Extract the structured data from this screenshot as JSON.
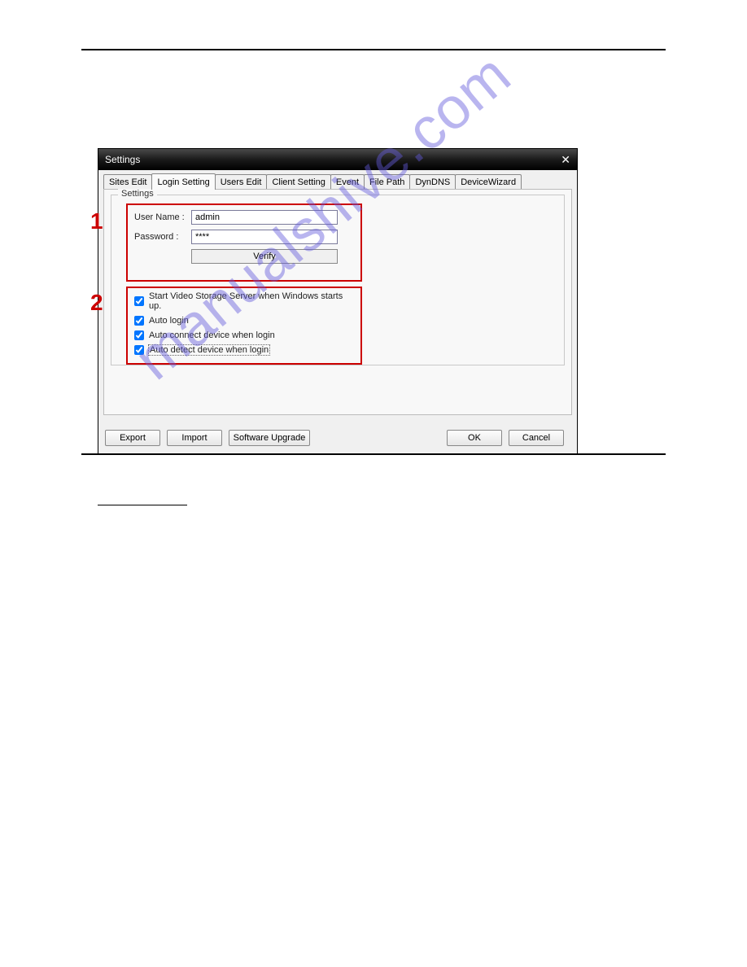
{
  "watermark": "manualshive.com",
  "dialog": {
    "title": "Settings",
    "tabs": [
      "Sites Edit",
      "Login Setting",
      "Users Edit",
      "Client Setting",
      "Event",
      "File Path",
      "DynDNS",
      "DeviceWizard"
    ],
    "activeTabIndex": 1,
    "groupbox_legend": "Settings",
    "annotations": {
      "num1": "1",
      "num2": "2"
    },
    "fields": {
      "username_label": "User Name :",
      "username_value": "admin",
      "password_label": "Password :",
      "password_value": "****",
      "verify_label": "Verify"
    },
    "checkboxes": [
      {
        "label": "Start Video Storage Server when Windows starts up.",
        "checked": true
      },
      {
        "label": "Auto login",
        "checked": true
      },
      {
        "label": "Auto connect device when login",
        "checked": true
      },
      {
        "label": "Auto detect device when login",
        "checked": true,
        "focused": true
      }
    ],
    "buttons": {
      "export": "Export",
      "import": "Import",
      "upgrade": "Software Upgrade",
      "ok": "OK",
      "cancel": "Cancel"
    }
  }
}
